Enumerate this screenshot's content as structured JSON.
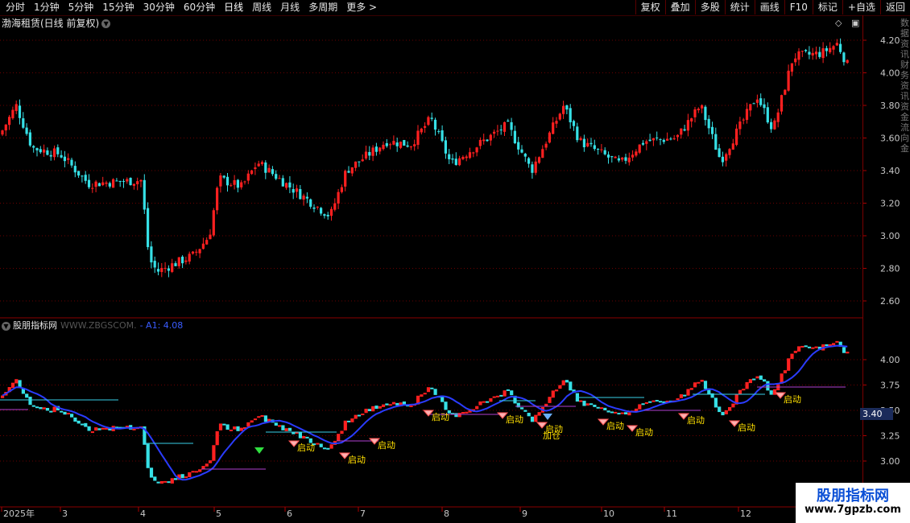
{
  "toolbar": {
    "periods": [
      "分时",
      "1分钟",
      "5分钟",
      "15分钟",
      "30分钟",
      "60分钟",
      "日线",
      "周线",
      "月线",
      "多周期",
      "更多 >"
    ],
    "right": [
      "复权",
      "叠加",
      "多股",
      "统计",
      "画线",
      "F10",
      "标记",
      "+自选",
      "返回"
    ]
  },
  "stock": {
    "title": "渤海租赁(日线 前复权)"
  },
  "indicator": {
    "name": "股朋指标网",
    "source": "WWW.ZBGSCOM.",
    "a1": "- A1: 4.08"
  },
  "axis": {
    "price_ticks": [
      "4.20",
      "4.00",
      "3.80",
      "3.60",
      "3.40",
      "3.20",
      "3.00",
      "2.80",
      "2.60"
    ],
    "ind_ticks": [
      "4.00",
      "3.75",
      "3.50",
      "3.25",
      "3.00"
    ],
    "current_tag": "3.40",
    "months": [
      "2025年",
      "3",
      "4",
      "5",
      "6",
      "7",
      "8",
      "9",
      "10",
      "11",
      "12"
    ]
  },
  "signals": {
    "start": "启动",
    "add": "加仓"
  },
  "right_vertical": "数据资讯财务资讯资金流向金",
  "watermark": {
    "line1": "股朋指标网",
    "line2": "www.7gpzb.com"
  },
  "colors": {
    "up": "#ff2020",
    "down": "#36e0e6",
    "ma": "#2a3cff",
    "grid": "#6a0000",
    "level": "#b040d0",
    "level2": "#38d0e8"
  }
}
